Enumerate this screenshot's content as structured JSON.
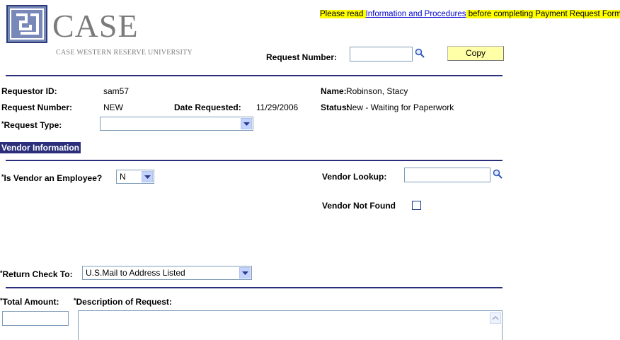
{
  "logo": {
    "wordmark": "CASE",
    "subtitle": "CASE WESTERN RESERVE UNIVERSITY"
  },
  "notice": {
    "prefix": "Please read ",
    "link": "Information and Procedures",
    "suffix": " before completing Payment Request Form"
  },
  "search": {
    "label": "Request Number:",
    "value": "",
    "copy_label": "Copy"
  },
  "request": {
    "requestor_id_label": "Requestor ID:",
    "requestor_id": "sam57",
    "request_number_label": "Request Number:",
    "request_number": "NEW",
    "date_label": "Date Requested:",
    "date": "11/29/2006",
    "name_label": "Name:",
    "name": "Robinson, Stacy",
    "status_label": "Status:",
    "status": "New - Waiting for Paperwork",
    "type_label": "Request Type:",
    "type_value": ""
  },
  "vendor": {
    "section_title": "Vendor Information",
    "employee_label": "Is Vendor an Employee?",
    "employee_value": "N",
    "lookup_label": "Vendor Lookup:",
    "lookup_value": "",
    "not_found_label": "Vendor Not Found",
    "not_found_checked": false
  },
  "return_check": {
    "label": "Return Check To:",
    "value": "U.S.Mail to Address Listed"
  },
  "amount": {
    "total_label": "Total Amount:",
    "total_value": "",
    "description_label": "Description of Request:",
    "description_value": ""
  },
  "colors": {
    "navy": "#2b2e7a",
    "highlight": "#ffff00",
    "button": "#ffffa8",
    "link": "#0000cc"
  }
}
